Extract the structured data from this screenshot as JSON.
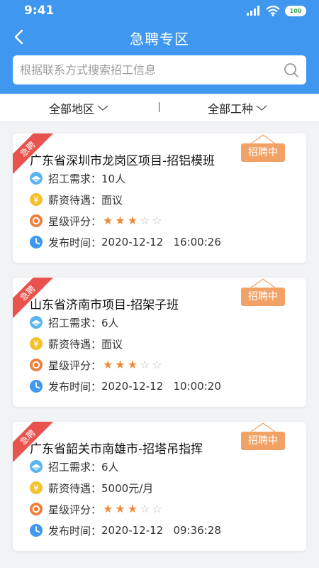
{
  "status_bar": {
    "time": "9:41",
    "battery": "100"
  },
  "nav": {
    "title": "急聘专区"
  },
  "search": {
    "placeholder": "根据联系方式搜索招工信息"
  },
  "filters": {
    "region": "全部地区",
    "job_type": "全部工种"
  },
  "labels": {
    "ribbon": "急聘",
    "hiring": "招聘中",
    "demand": "招工需求：",
    "salary": "薪资待遇：",
    "rating": "星级评分：",
    "publish": "发布时间："
  },
  "jobs": [
    {
      "title": "广东省深圳市龙岗区项目-招铝模班",
      "demand": "10人",
      "salary": "面议",
      "rating": 3,
      "max_rating": 5,
      "publish_time": "2020-12-12   16:00:26"
    },
    {
      "title": "山东省济南市项目-招架子班",
      "demand": "6人",
      "salary": "面议",
      "rating": 3,
      "max_rating": 5,
      "publish_time": "2020-12-12   10:00:20"
    },
    {
      "title": "广东省韶关市南雄市-招塔吊指挥",
      "demand": "6人",
      "salary": "5000元/月",
      "rating": 3,
      "max_rating": 5,
      "publish_time": "2020-12-12   09:36:28"
    }
  ],
  "colors": {
    "header_blue": "#3f97f0",
    "ribbon_red": "#e8534d",
    "tag_orange": "#f3a266",
    "star_orange": "#ef8c3c"
  }
}
